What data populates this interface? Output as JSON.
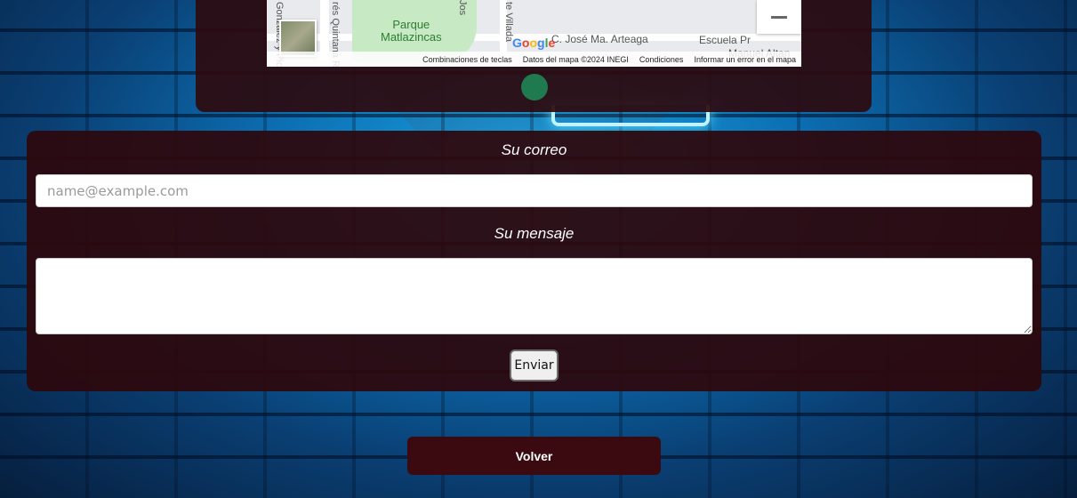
{
  "map": {
    "park_label_line1": "Parque",
    "park_label_line2": "Matlazincas",
    "street_1": "C. José Ma. Arteaga",
    "street_2": "Escuela Pr",
    "street_3": "Manuel Altan",
    "vstreet_1": "Gonzalez y Pic",
    "vstreet_2": "rés Quintana R",
    "vstreet_3": "te Villada",
    "vstreet_4": "Jos",
    "google_logo": "Google",
    "attribution": {
      "shortcuts": "Combinaciones de teclas",
      "map_data": "Datos del mapa ©2024 INEGI",
      "terms": "Condiciones",
      "report": "Informar un error en el mapa"
    }
  },
  "form": {
    "email_label": "Su correo",
    "email_placeholder": "name@example.com",
    "message_label": "Su mensaje",
    "send_label": "Enviar"
  },
  "nav": {
    "back_label": "Volver"
  }
}
